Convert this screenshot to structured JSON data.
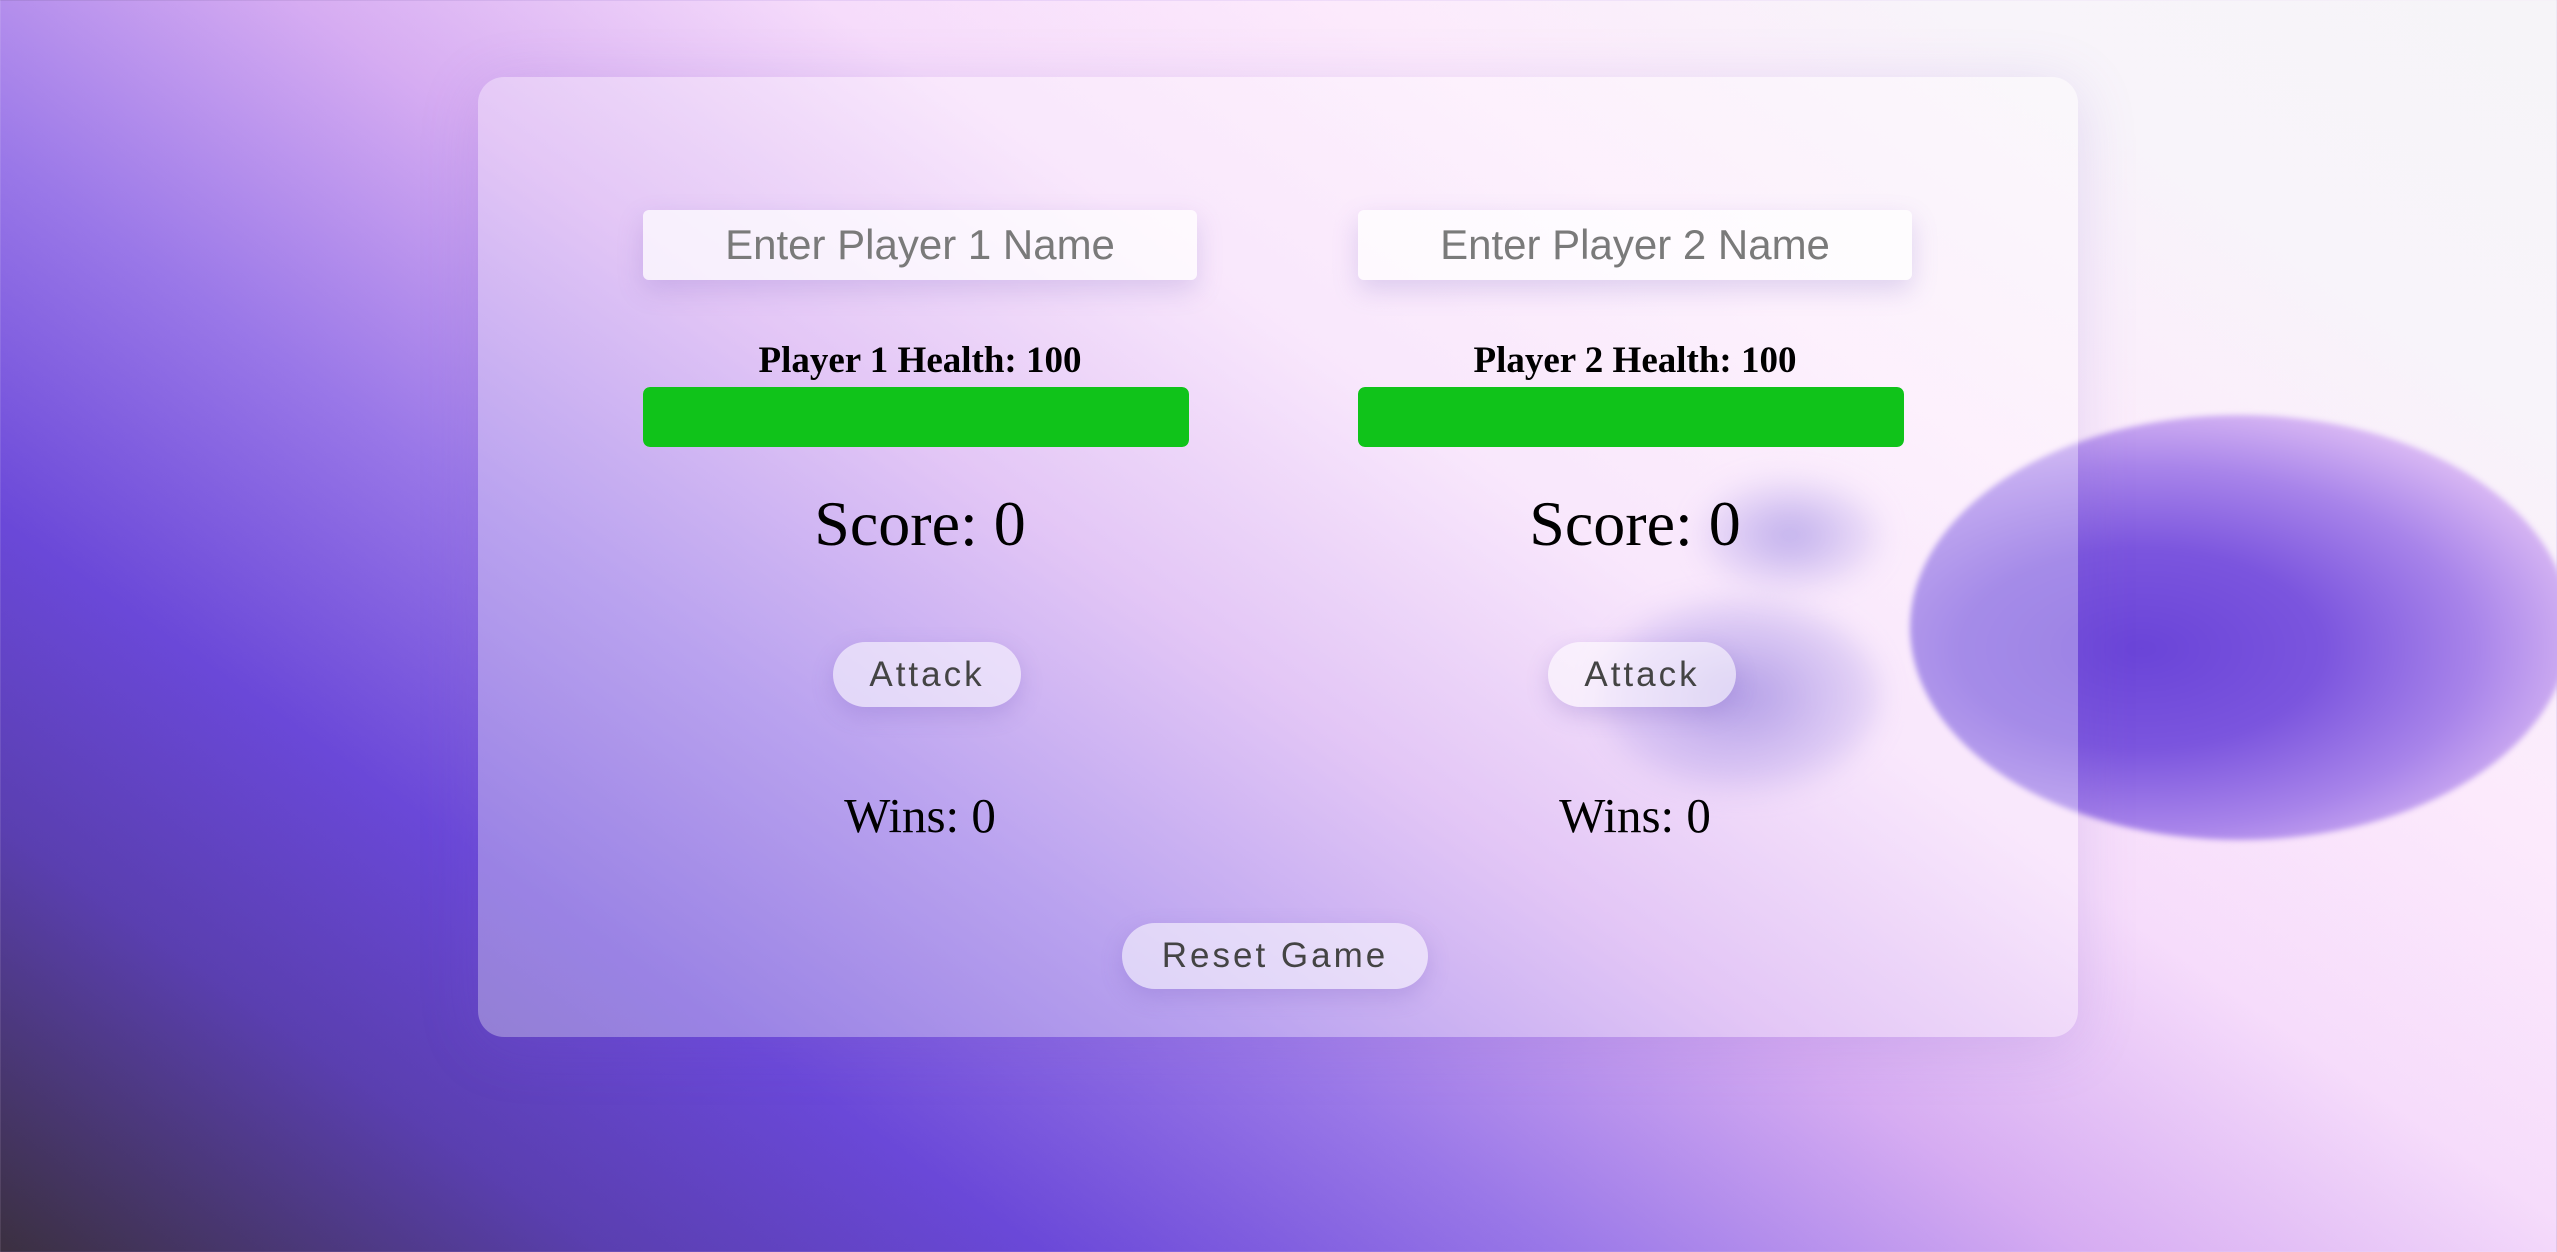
{
  "players": [
    {
      "name_placeholder": "Enter Player 1 Name",
      "name_value": "",
      "health_label": "Player 1 Health: 100",
      "health": 100,
      "health_max": 100,
      "score_label": "Score: 0",
      "attack_label": "Attack",
      "wins_label": "Wins: 0"
    },
    {
      "name_placeholder": "Enter Player 2 Name",
      "name_value": "",
      "health_label": "Player 2 Health: 100",
      "health": 100,
      "health_max": 100,
      "score_label": "Score: 0",
      "attack_label": "Attack",
      "wins_label": "Wins: 0"
    }
  ],
  "reset_label": "Reset Game",
  "colors": {
    "health_bar": "#10c31a",
    "accent_purple": "#6a48d8"
  }
}
